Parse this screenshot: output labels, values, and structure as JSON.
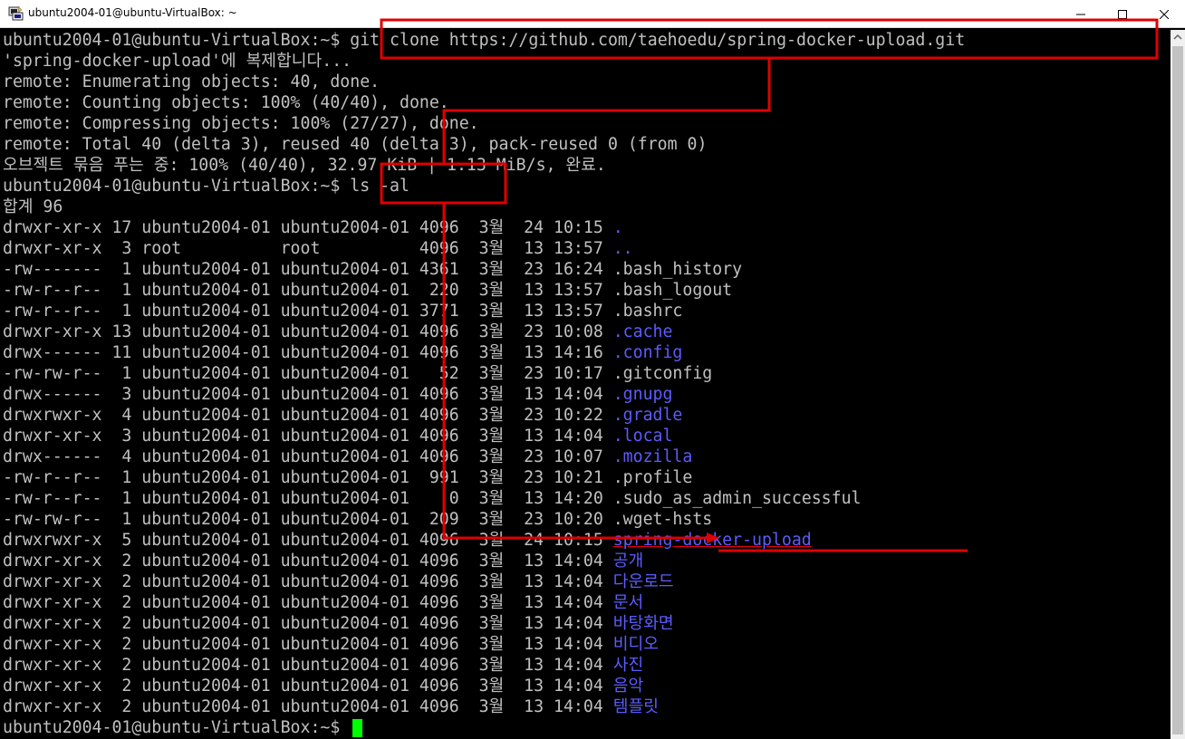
{
  "window": {
    "title": "ubuntu2004-01@ubuntu-VirtualBox: ~",
    "icon": "putty-icon",
    "controls": [
      "minimize-icon",
      "maximize-icon",
      "close-icon"
    ]
  },
  "colors": {
    "background": "#000000",
    "text": "#c0c0c0",
    "directory": "#5c5cff",
    "cursor": "#00ff00",
    "annotation": "#e00000"
  },
  "terminal": {
    "prompt": "ubuntu2004-01@ubuntu-VirtualBox:~$ ",
    "cmd_clone": "git clone https://github.com/taehoedu/spring-docker-upload.git",
    "clone_output": [
      "'spring-docker-upload'에 복제합니다...",
      "remote: Enumerating objects: 40, done.",
      "remote: Counting objects: 100% (40/40), done.",
      "remote: Compressing objects: 100% (27/27), done.",
      "remote: Total 40 (delta 3), reused 40 (delta 3), pack-reused 0 (from 0)",
      "오브젝트 묶음 푸는 중: 100% (40/40), 32.97 KiB | 1.13 MiB/s, 완료."
    ],
    "cmd_ls": "ls -al",
    "total_line": "합계 96",
    "listing": [
      {
        "prefix": "drwxr-xr-x 17 ubuntu2004-01 ubuntu2004-01 4096  3월  24 10:15 ",
        "name": ".",
        "dir": true
      },
      {
        "prefix": "drwxr-xr-x  3 root          root          4096  3월  13 13:57 ",
        "name": "..",
        "dir": true
      },
      {
        "prefix": "-rw-------  1 ubuntu2004-01 ubuntu2004-01 4361  3월  23 16:24 ",
        "name": ".bash_history",
        "dir": false
      },
      {
        "prefix": "-rw-r--r--  1 ubuntu2004-01 ubuntu2004-01  220  3월  13 13:57 ",
        "name": ".bash_logout",
        "dir": false
      },
      {
        "prefix": "-rw-r--r--  1 ubuntu2004-01 ubuntu2004-01 3771  3월  13 13:57 ",
        "name": ".bashrc",
        "dir": false
      },
      {
        "prefix": "drwxr-xr-x 13 ubuntu2004-01 ubuntu2004-01 4096  3월  23 10:08 ",
        "name": ".cache",
        "dir": true
      },
      {
        "prefix": "drwx------ 11 ubuntu2004-01 ubuntu2004-01 4096  3월  13 14:16 ",
        "name": ".config",
        "dir": true
      },
      {
        "prefix": "-rw-rw-r--  1 ubuntu2004-01 ubuntu2004-01   52  3월  23 10:17 ",
        "name": ".gitconfig",
        "dir": false
      },
      {
        "prefix": "drwx------  3 ubuntu2004-01 ubuntu2004-01 4096  3월  13 14:04 ",
        "name": ".gnupg",
        "dir": true
      },
      {
        "prefix": "drwxrwxr-x  4 ubuntu2004-01 ubuntu2004-01 4096  3월  23 10:22 ",
        "name": ".gradle",
        "dir": true
      },
      {
        "prefix": "drwxr-xr-x  3 ubuntu2004-01 ubuntu2004-01 4096  3월  13 14:04 ",
        "name": ".local",
        "dir": true
      },
      {
        "prefix": "drwx------  4 ubuntu2004-01 ubuntu2004-01 4096  3월  23 10:07 ",
        "name": ".mozilla",
        "dir": true
      },
      {
        "prefix": "-rw-r--r--  1 ubuntu2004-01 ubuntu2004-01  991  3월  23 10:21 ",
        "name": ".profile",
        "dir": false
      },
      {
        "prefix": "-rw-r--r--  1 ubuntu2004-01 ubuntu2004-01    0  3월  13 14:20 ",
        "name": ".sudo_as_admin_successful",
        "dir": false
      },
      {
        "prefix": "-rw-rw-r--  1 ubuntu2004-01 ubuntu2004-01  209  3월  23 10:20 ",
        "name": ".wget-hsts",
        "dir": false
      },
      {
        "prefix": "drwxrwxr-x  5 ubuntu2004-01 ubuntu2004-01 4096  3월  24 10:15 ",
        "name": "spring-docker-upload",
        "dir": true,
        "highlight": true
      },
      {
        "prefix": "drwxr-xr-x  2 ubuntu2004-01 ubuntu2004-01 4096  3월  13 14:04 ",
        "name": "공개",
        "dir": true
      },
      {
        "prefix": "drwxr-xr-x  2 ubuntu2004-01 ubuntu2004-01 4096  3월  13 14:04 ",
        "name": "다운로드",
        "dir": true
      },
      {
        "prefix": "drwxr-xr-x  2 ubuntu2004-01 ubuntu2004-01 4096  3월  13 14:04 ",
        "name": "문서",
        "dir": true
      },
      {
        "prefix": "drwxr-xr-x  2 ubuntu2004-01 ubuntu2004-01 4096  3월  13 14:04 ",
        "name": "바탕화면",
        "dir": true
      },
      {
        "prefix": "drwxr-xr-x  2 ubuntu2004-01 ubuntu2004-01 4096  3월  13 14:04 ",
        "name": "비디오",
        "dir": true
      },
      {
        "prefix": "drwxr-xr-x  2 ubuntu2004-01 ubuntu2004-01 4096  3월  13 14:04 ",
        "name": "사진",
        "dir": true
      },
      {
        "prefix": "drwxr-xr-x  2 ubuntu2004-01 ubuntu2004-01 4096  3월  13 14:04 ",
        "name": "음악",
        "dir": true
      },
      {
        "prefix": "drwxr-xr-x  2 ubuntu2004-01 ubuntu2004-01 4096  3월  13 14:04 ",
        "name": "템플릿",
        "dir": true
      }
    ]
  }
}
